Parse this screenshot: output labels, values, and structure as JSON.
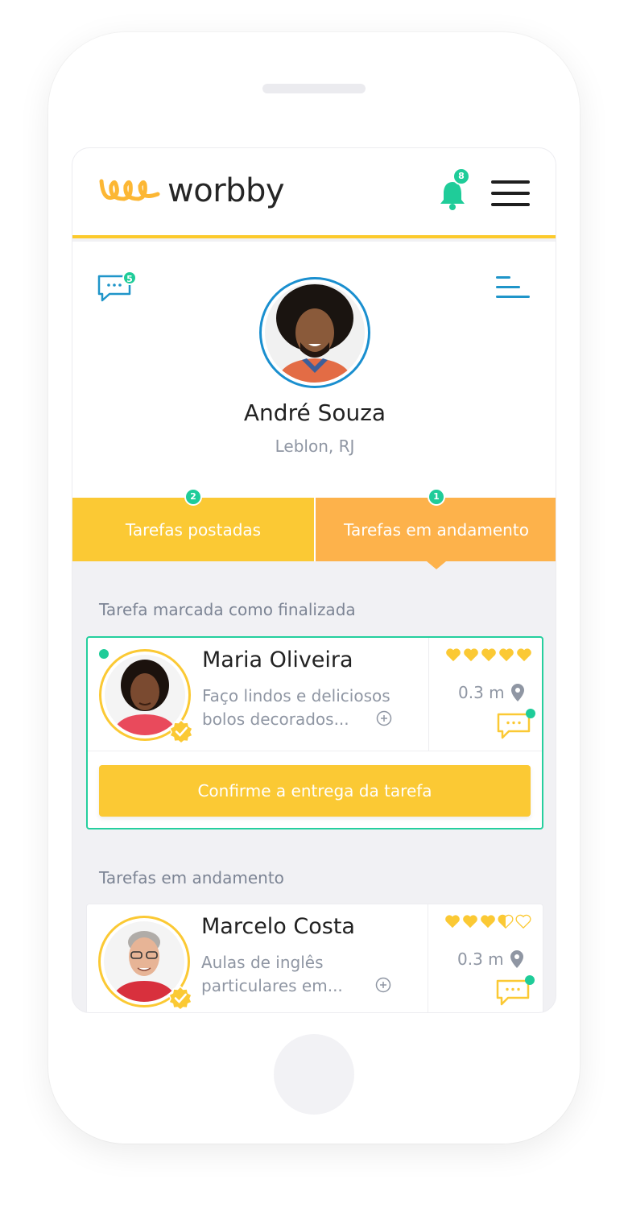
{
  "app": {
    "logo_text": "worbby",
    "notifications_count": "8"
  },
  "profile": {
    "messages_count": "5",
    "name": "André Souza",
    "location": "Leblon, RJ"
  },
  "tabs": [
    {
      "label": "Tarefas postadas",
      "count": "2"
    },
    {
      "label": "Tarefas em andamento",
      "count": "1"
    }
  ],
  "sections": {
    "done_title": "Tarefa marcada como finalizada",
    "running_title": "Tarefas em andamento"
  },
  "tasks": [
    {
      "name": "Maria Oliveira",
      "description": "Faço lindos e deliciosos bolos decorados...",
      "rating": 5,
      "distance": "0.3 m",
      "action_label": "Confirme a entrega da tarefa"
    },
    {
      "name": "Marcelo Costa",
      "description": "Aulas de inglês particulares em...",
      "rating": 3.5,
      "distance": "0.3 m"
    }
  ],
  "colors": {
    "brand_yellow": "#fbc934",
    "brand_orange": "#fdb24b",
    "accent_green": "#1fcc99",
    "accent_blue": "#1a8fcf"
  }
}
